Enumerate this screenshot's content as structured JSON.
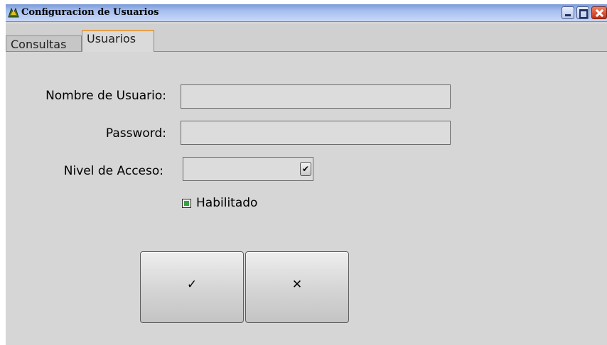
{
  "window": {
    "title": "Configuracion de Usuarios",
    "icon": "app-logo-icon",
    "controls": [
      "minimize-icon",
      "maximize-icon",
      "close-icon"
    ]
  },
  "tabs": [
    {
      "label": "Consultas",
      "active": false
    },
    {
      "label": "Usuarios",
      "active": true
    }
  ],
  "form": {
    "username": {
      "label": "Nombre de Usuario:",
      "value": ""
    },
    "password": {
      "label": "Password:",
      "value": ""
    },
    "access_level": {
      "label": "Nivel de Acceso:",
      "selected": ""
    },
    "enabled": {
      "label": "Habilitado",
      "checked": true
    }
  },
  "buttons": {
    "accept_glyph": "✓",
    "accept_icon": "check-icon",
    "cancel_glyph": "✕",
    "cancel_icon": "cross-icon"
  },
  "colors": {
    "active_tab_accent": "#e6a04a",
    "checkbox_fill": "#3aa040",
    "close_button": "#c03018"
  }
}
